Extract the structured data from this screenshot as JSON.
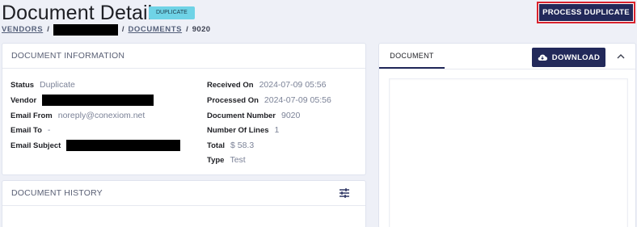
{
  "header": {
    "title": "Document Details",
    "badge": "DUPLICATE",
    "process_button": "PROCESS DUPLICATE"
  },
  "breadcrumb": {
    "vendors": "VENDORS",
    "separator": "/",
    "documents": "DOCUMENTS",
    "current": "9020"
  },
  "info": {
    "title": "DOCUMENT INFORMATION",
    "status_label": "Status",
    "status_value": "Duplicate",
    "vendor_label": "Vendor",
    "email_from_label": "Email From",
    "email_from_value": "noreply@conexiom.net",
    "email_to_label": "Email To",
    "email_to_value": "-",
    "email_subject_label": "Email Subject",
    "received_label": "Received On",
    "received_value": "2024-07-09 05:56",
    "processed_label": "Processed On",
    "processed_value": "2024-07-09 05:56",
    "doc_number_label": "Document Number",
    "doc_number_value": "9020",
    "lines_label": "Number Of Lines",
    "lines_value": "1",
    "total_label": "Total",
    "total_value": "$ 58.3",
    "type_label": "Type",
    "type_value": "Test"
  },
  "history": {
    "title": "DOCUMENT HISTORY"
  },
  "document": {
    "tab_label": "DOCUMENT",
    "download_label": "DOWNLOAD"
  },
  "colors": {
    "primary": "#22295a",
    "badge": "#6fd3e6",
    "highlight_border": "#d9232e"
  }
}
